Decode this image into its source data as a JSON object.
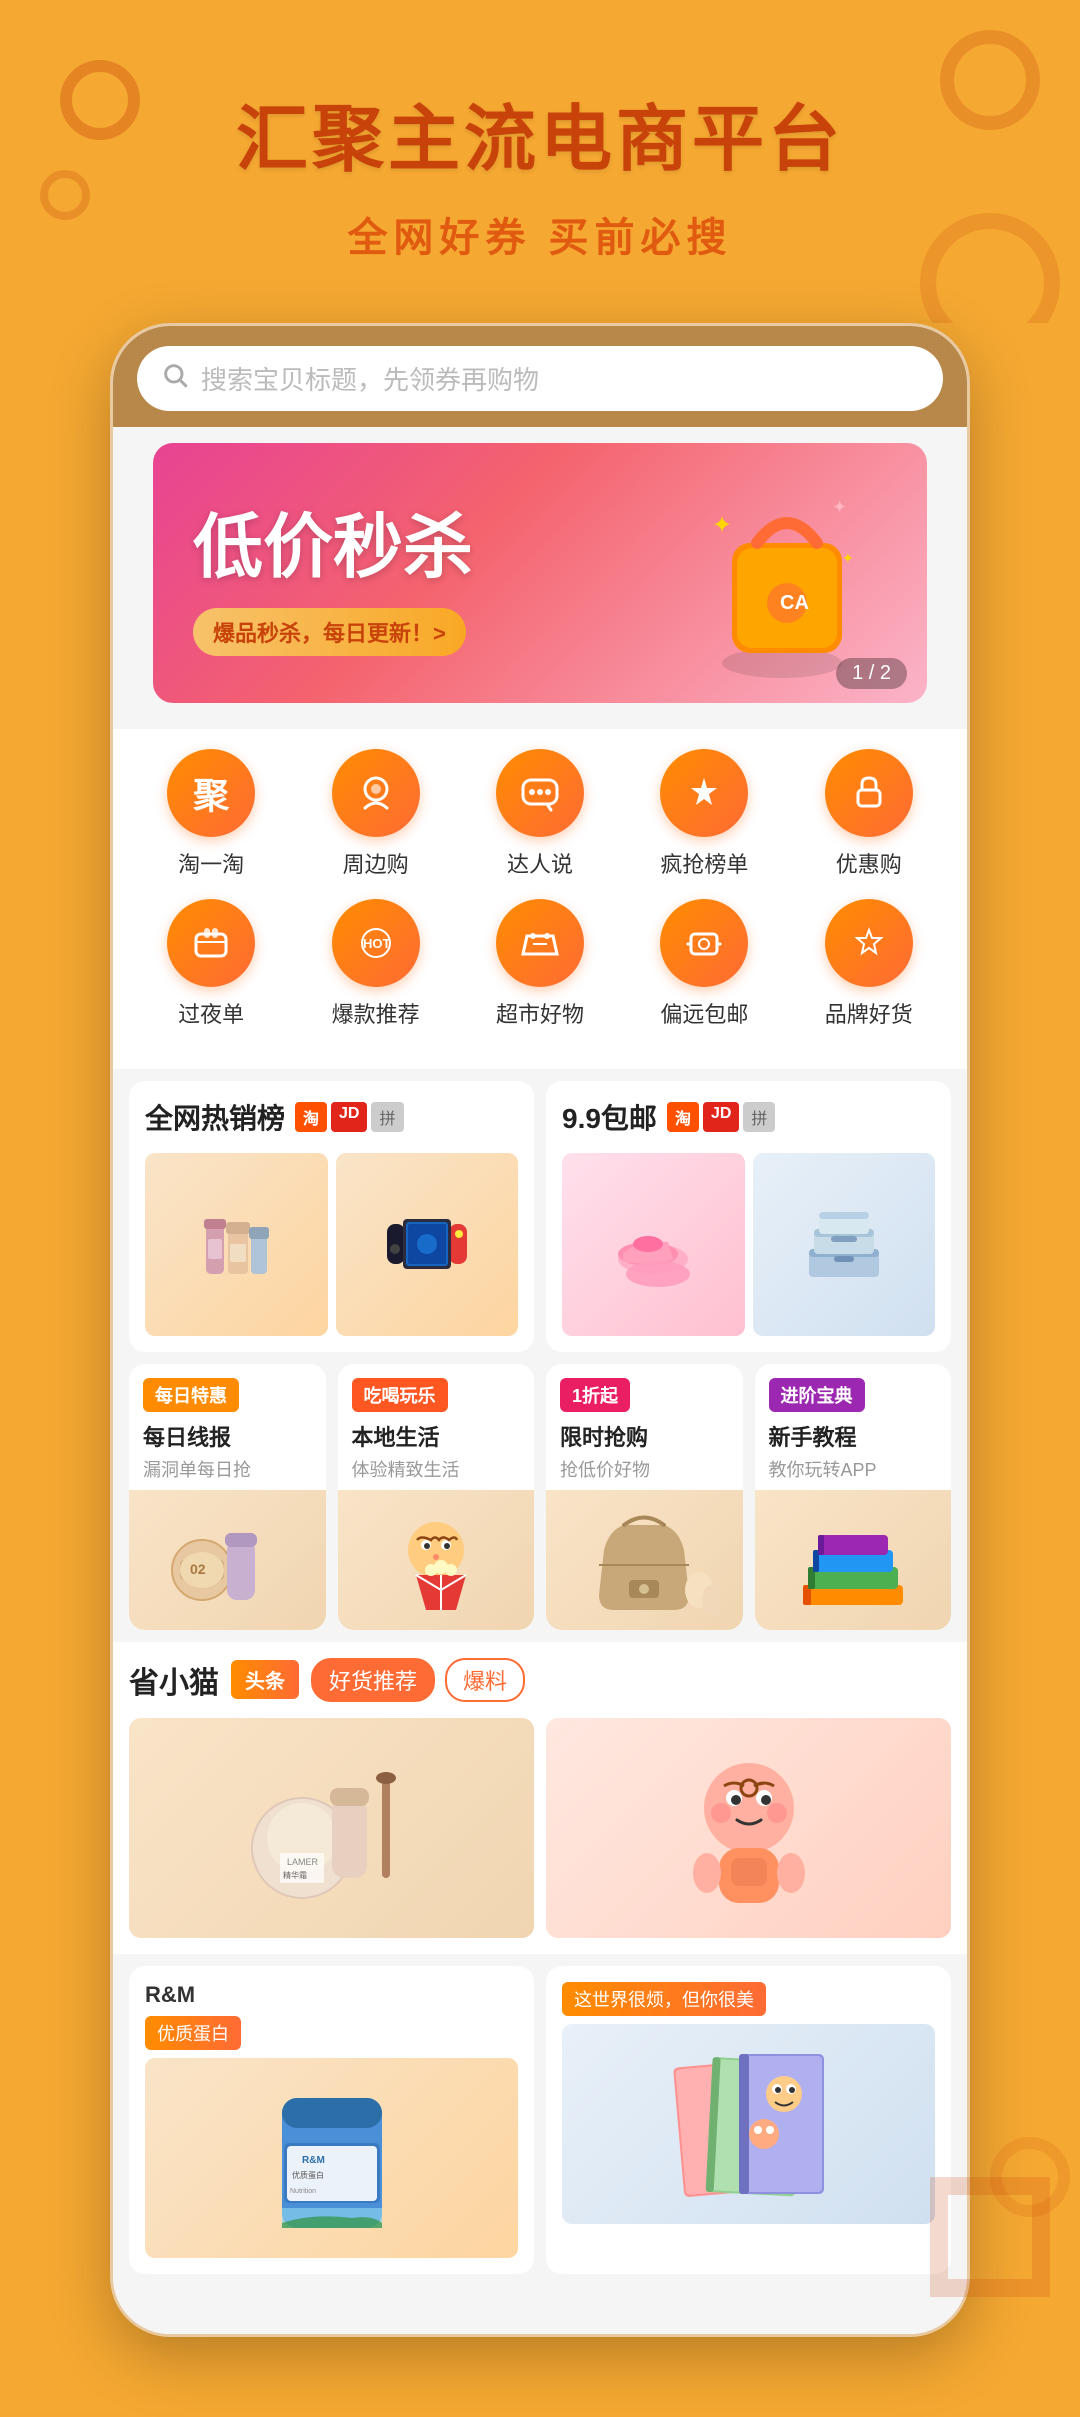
{
  "header": {
    "title": "汇聚主流电商平台",
    "subtitle": "全网好券 买前必搜"
  },
  "search": {
    "placeholder": "搜索宝贝标题，先领券再购物"
  },
  "banner": {
    "title": "低价秒杀",
    "tag": "爆品秒杀，每日更新！>",
    "indicator": "1 / 2"
  },
  "categories": {
    "row1": [
      {
        "label": "淘一淘",
        "icon": "聚"
      },
      {
        "label": "周边购",
        "icon": "♡"
      },
      {
        "label": "达人说",
        "icon": "💬"
      },
      {
        "label": "疯抢榜单",
        "icon": "🔥"
      },
      {
        "label": "优惠购",
        "icon": "🎁"
      }
    ],
    "row2": [
      {
        "label": "过夜单",
        "icon": "📋"
      },
      {
        "label": "爆款推荐",
        "icon": "HOT"
      },
      {
        "label": "超市好物",
        "icon": "🛒"
      },
      {
        "label": "偏远包邮",
        "icon": "📦"
      },
      {
        "label": "品牌好货",
        "icon": "💎"
      }
    ]
  },
  "hot_sales": {
    "title": "全网热销榜",
    "platforms": [
      "淘",
      "JD",
      "拼多多"
    ]
  },
  "package": {
    "title": "9.9包邮",
    "platforms": [
      "淘",
      "JD",
      "拼多多"
    ]
  },
  "features": [
    {
      "badge": "每日特惠",
      "badge_class": "badge-daily",
      "title": "每日线报",
      "sub": "漏洞单每日抢"
    },
    {
      "badge": "吃喝玩乐",
      "badge_class": "badge-food",
      "title": "本地生活",
      "sub": "体验精致生活"
    },
    {
      "badge": "1折起",
      "badge_class": "badge-flash",
      "title": "限时抢购",
      "sub": "抢低价好物"
    },
    {
      "badge": "进阶宝典",
      "badge_class": "badge-guide",
      "title": "新手教程",
      "sub": "教你玩转APP"
    }
  ],
  "sheng_section": {
    "title": "省小猫",
    "badge": "头条",
    "tabs": [
      "好货推荐",
      "爆料"
    ]
  },
  "bottom_promos": [
    {
      "brand": "R&M",
      "label": "优质蛋白"
    },
    {
      "label": "这世界很烦，但你很美"
    }
  ]
}
